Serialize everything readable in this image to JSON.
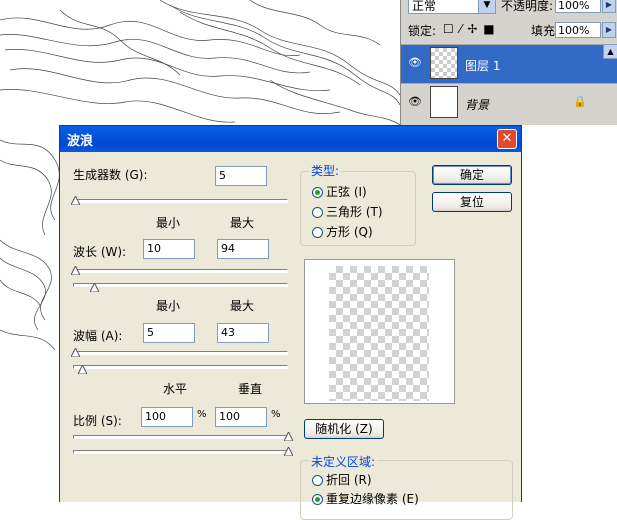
{
  "layers_panel": {
    "blend_mode": "正常",
    "opacity_label": "不透明度:",
    "opacity_value": "100%",
    "lock_label": "锁定:",
    "lock_icons": "☐ ⁄ ✢ ■",
    "fill_label": "填充:",
    "fill_value": "100%",
    "layers": [
      {
        "name": "图层 1",
        "selected": true
      },
      {
        "name": "背景",
        "locked": true
      }
    ]
  },
  "dialog": {
    "title": "波浪",
    "generators_label": "生成器数 (G):",
    "generators_value": "5",
    "min_label": "最小",
    "max_label": "最大",
    "wavelength_label": "波长 (W):",
    "wavelength_min": "10",
    "wavelength_max": "94",
    "amplitude_label": "波幅 (A):",
    "amplitude_min": "5",
    "amplitude_max": "43",
    "horizontal_label": "水平",
    "vertical_label": "垂直",
    "scale_label": "比例 (S):",
    "scale_h": "100",
    "scale_v": "100",
    "percent": "%",
    "type_group": "类型:",
    "type_options": [
      "正弦 (I)",
      "三角形 (T)",
      "方形 (Q)"
    ],
    "ok_button": "确定",
    "reset_button": "复位",
    "randomize_button": "随机化 (Z)",
    "undefined_group": "未定义区域:",
    "undefined_options": [
      "折回 (R)",
      "重复边缘像素 (E)"
    ]
  }
}
